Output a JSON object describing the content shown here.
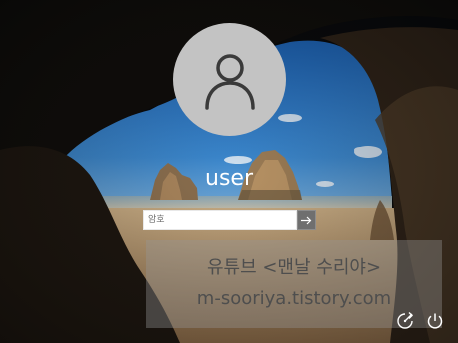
{
  "user": {
    "name": "user",
    "avatar_icon": "person-silhouette-icon"
  },
  "password": {
    "placeholder": "암호",
    "value": "",
    "submit_icon": "arrow-right-icon"
  },
  "watermark": {
    "line1": "유튜브 <맨날 수리야>",
    "line2": "m-sooriya.tistory.com"
  },
  "corner_buttons": {
    "accessibility_icon": "ease-of-access-icon",
    "power_icon": "power-icon"
  },
  "colors": {
    "avatar_bg": "#c3c3c3",
    "avatar_glyph": "#3a3a3a",
    "submit_bg": "#6f6f6f",
    "text": "#ffffff"
  }
}
